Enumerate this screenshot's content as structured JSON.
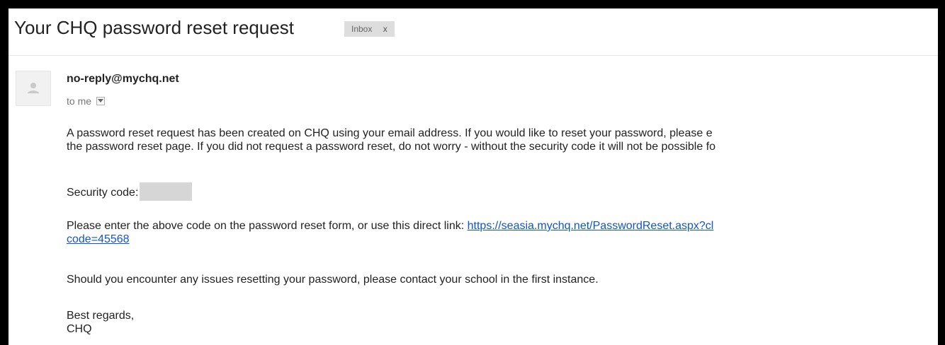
{
  "email": {
    "subject": "Your CHQ password reset request",
    "label": "Inbox",
    "label_close": "x",
    "sender": "no-reply@mychq.net",
    "recipient": "to me",
    "body": {
      "p1_line1": "A password reset request has been created on CHQ using your email address. If you would like to reset your password, please e",
      "p1_line2": "the password reset page. If you did not request a password reset, do not worry - without the security code it will not be possible fo",
      "security_label": "Security code:",
      "p3_text": "Please enter the above code on the password reset form, or use this direct link: ",
      "p3_link_line1": "https://seasia.mychq.net/PasswordReset.aspx?cl",
      "p3_link_line2": "code=45568",
      "p4": "Should you encounter any issues resetting your password, please contact your school in the first instance.",
      "sign_off": "Best regards,",
      "signature": "CHQ"
    }
  },
  "icons": {
    "avatar": "person-icon",
    "caret": "chevron-down-icon"
  }
}
